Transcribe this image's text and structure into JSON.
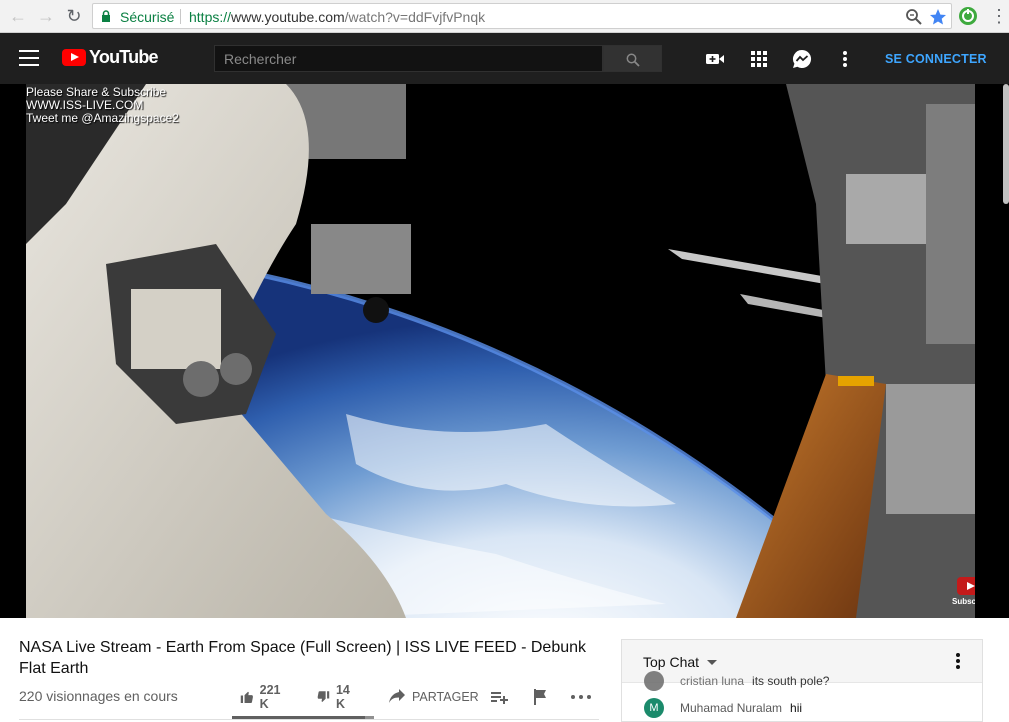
{
  "browser": {
    "secure_label": "Sécurisé",
    "url_protocol": "https://",
    "url_host": "www.youtube.com",
    "url_path": "/watch?v=ddFvjfvPnqk",
    "icons": [
      "back-icon",
      "forward-icon",
      "reload-icon",
      "lock-icon",
      "zoom-icon",
      "bookmark-star-icon",
      "extension-icon",
      "menu-icon"
    ]
  },
  "masthead": {
    "logo_text": "YouTube",
    "search_placeholder": "Rechercher",
    "signin_label": "SE CONNECTER",
    "brand_color": "#ff0000",
    "link_color": "#3ea6ff",
    "icons": [
      "menu-icon",
      "search-icon",
      "create-video-icon",
      "apps-grid-icon",
      "messages-icon",
      "more-vert-icon"
    ]
  },
  "video": {
    "overlay_lines": [
      "Please Share & Subscribe",
      "WWW.ISS-LIVE.COM",
      "Tweet me @Amazingspace2"
    ],
    "subscribe_badge": "Subscribe"
  },
  "info": {
    "title": "NASA Live Stream - Earth From Space (Full Screen) | ISS LIVE FEED - Debunk Flat Earth",
    "views": "220 visionnages en cours",
    "likes": "221 K",
    "dislikes": "14 K",
    "share_label": "PARTAGER",
    "like_ratio": 0.94
  },
  "chat": {
    "title": "Top Chat",
    "messages": [
      {
        "author": "cristian luna",
        "text": "its south pole?",
        "avatar_letter": "",
        "avatar_color": "#6b6b6b"
      },
      {
        "author": "Muhamad Nuralam",
        "text": "hii",
        "avatar_letter": "M",
        "avatar_color": "#1b8a6b"
      }
    ]
  }
}
